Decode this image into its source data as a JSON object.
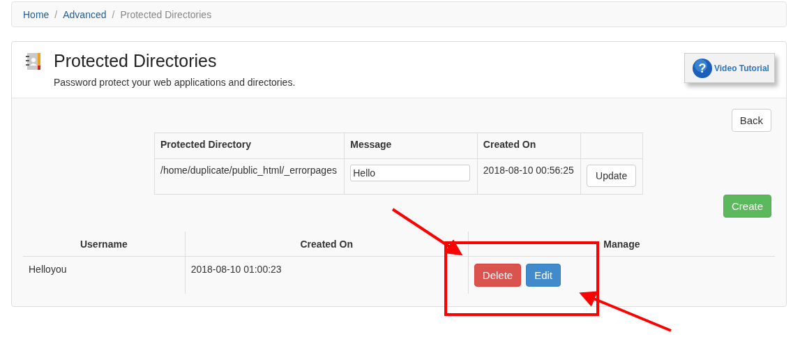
{
  "breadcrumb_separator": "/",
  "breadcrumb": [
    {
      "label": "Home",
      "kind": "link"
    },
    {
      "label": "Advanced",
      "kind": "link"
    },
    {
      "label": "Protected Directories",
      "kind": "current"
    }
  ],
  "header": {
    "title": "Protected Directories",
    "subtitle": "Password protect your web applications and directories.",
    "video_button": "Video Tutorial",
    "help_mark": "?"
  },
  "back_button": "Back",
  "directories": {
    "columns": [
      "Protected Directory",
      "Message",
      "Created On"
    ],
    "rows": [
      {
        "directory": "/home/duplicate/public_html/_errorpages",
        "message": "Hello",
        "created_on": "2018-08-10 00:56:25",
        "action": "Update"
      }
    ]
  },
  "create_button": "Create",
  "users": {
    "columns": [
      "Username",
      "Created On",
      "Manage"
    ],
    "rows": [
      {
        "username": "Helloyou",
        "created_on": "2018-08-10 01:00:23",
        "actions": [
          {
            "label": "Delete",
            "kind": "danger"
          },
          {
            "label": "Edit",
            "kind": "primary"
          }
        ]
      }
    ]
  }
}
